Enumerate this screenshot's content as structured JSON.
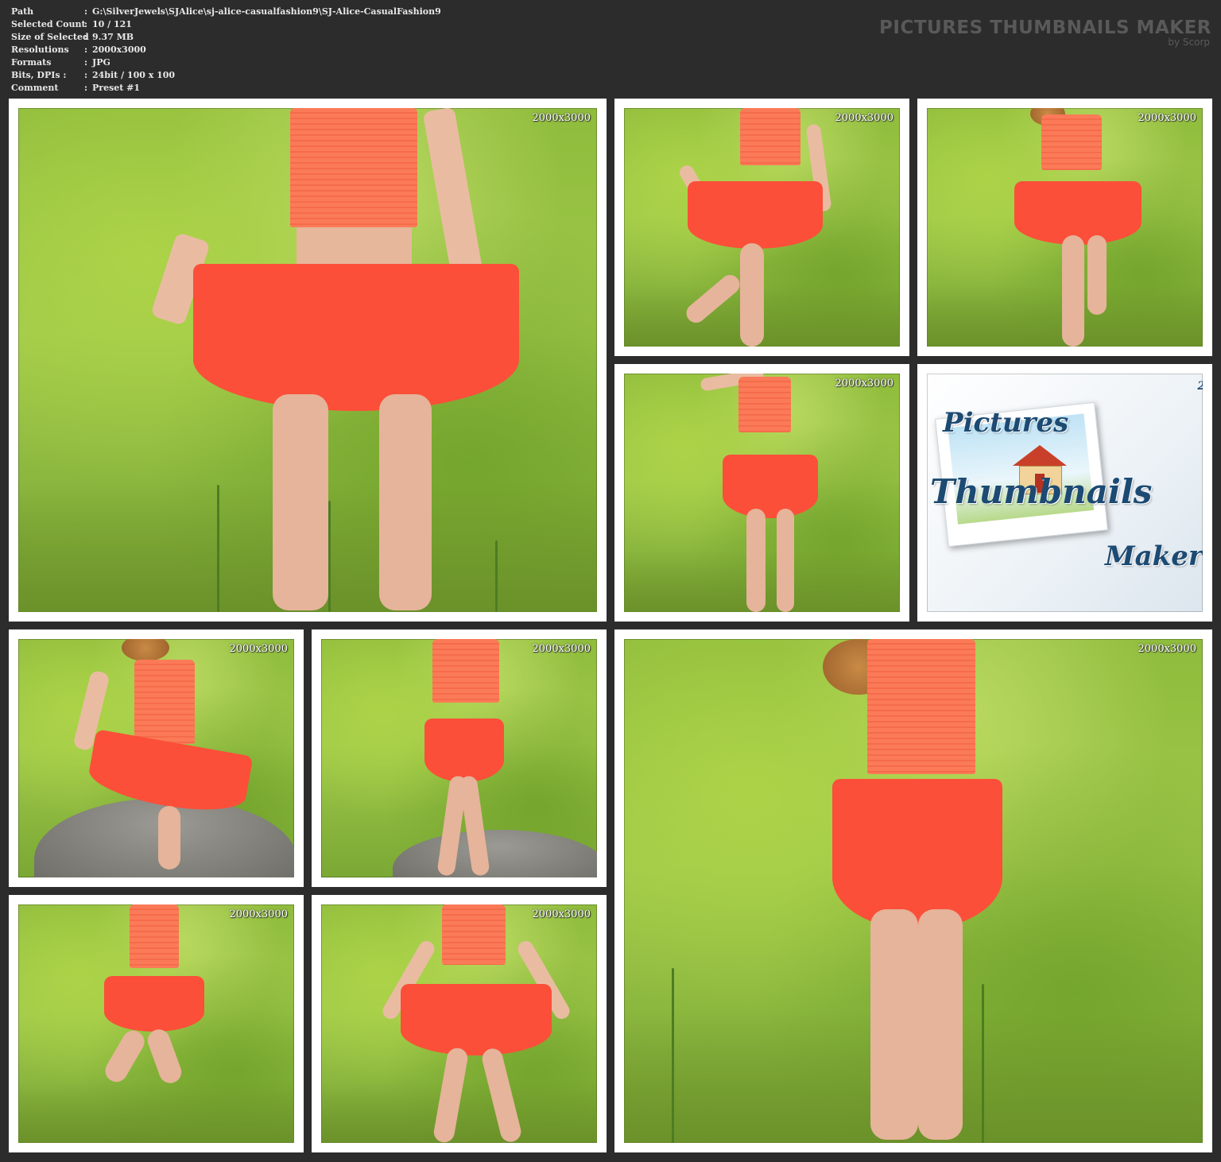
{
  "header": {
    "info": [
      {
        "label": "Path",
        "value": "G:\\SilverJewels\\SJAlice\\sj-alice-casualfashion9\\SJ-Alice-CasualFashion9"
      },
      {
        "label": "Selected Count",
        "value": "10 / 121"
      },
      {
        "label": "Size of Selected",
        "value": "9.37 MB"
      },
      {
        "label": "Resolutions",
        "value": "2000x3000"
      },
      {
        "label": "Formats",
        "value": "JPG"
      },
      {
        "label": "Bits, DPIs :",
        "value": "24bit / 100 x 100"
      },
      {
        "label": "Comment",
        "value": "Preset #1"
      }
    ],
    "separator": ":",
    "brand_title": "PICTURES THUMBNAILS MAKER",
    "brand_subtitle": "by Scorp"
  },
  "thumbnails": [
    {
      "resolution": "2000x3000"
    },
    {
      "resolution": "2000x3000"
    },
    {
      "resolution": "2000x3000"
    },
    {
      "resolution": "2000x3000"
    },
    {
      "resolution": "2000x3000"
    },
    {
      "resolution": "2000x3000"
    },
    {
      "resolution": "2000x3000"
    },
    {
      "resolution": "2000x3000"
    },
    {
      "resolution": "2000x3000"
    }
  ],
  "logo_tile": {
    "line1": "Pictures",
    "line2": "Thumbnails",
    "line3": "Maker",
    "corner": "2.",
    "colors": {
      "text": "#1c4a72",
      "roof": "#c9402a"
    }
  },
  "colors": {
    "background": "#2c2c2c",
    "frame": "#ffffff",
    "info_text": "#e8e8e8",
    "brand_text": "#595959",
    "skirt": "#fb4f39",
    "top": "#fb7a58",
    "foliage": "#8fbc3c"
  }
}
